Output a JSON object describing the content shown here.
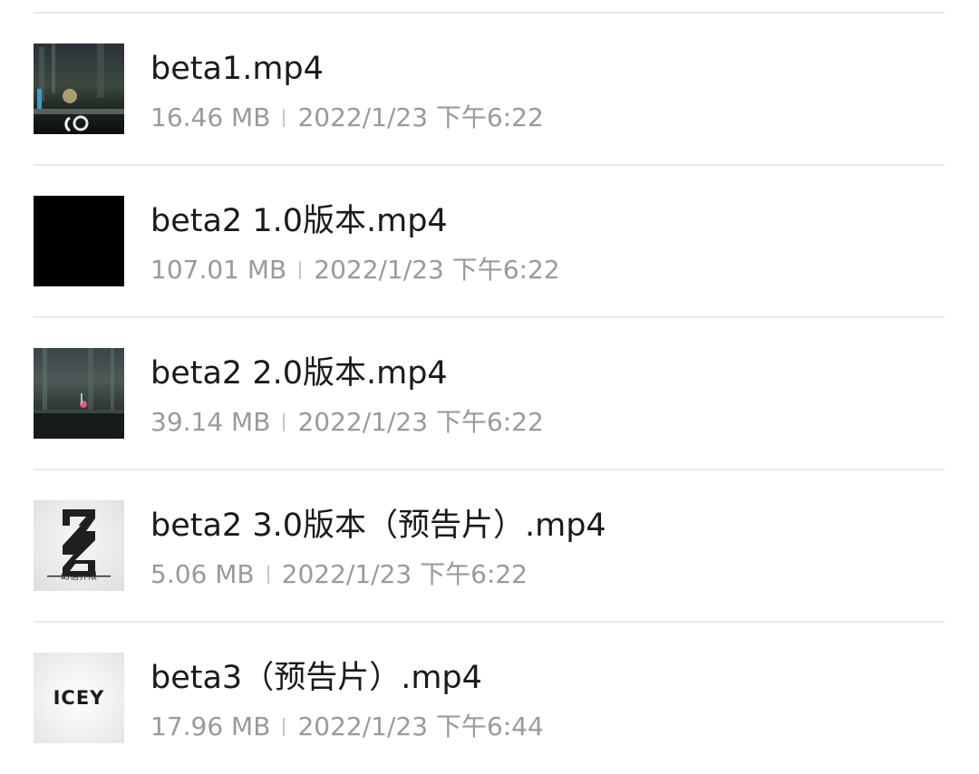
{
  "files": [
    {
      "name": "beta1.mp4",
      "size": "16.46 MB",
      "date": "2022/1/23 下午6:22",
      "thumbnail": "game-scene-thumbnail"
    },
    {
      "name": "beta2 1.0版本.mp4",
      "size": "107.01 MB",
      "date": "2022/1/23 下午6:22",
      "thumbnail": "black-thumbnail"
    },
    {
      "name": "beta2 2.0版本.mp4",
      "size": "39.14 MB",
      "date": "2022/1/23 下午6:22",
      "thumbnail": "forest-scene-thumbnail"
    },
    {
      "name": "beta2 3.0版本（预告片）.mp4",
      "size": "5.06 MB",
      "date": "2022/1/23 下午6:22",
      "thumbnail": "logo-thumbnail",
      "logo_text": "幻信界限"
    },
    {
      "name": "beta3（预告片）.mp4",
      "size": "17.96 MB",
      "date": "2022/1/23 下午6:44",
      "thumbnail": "icey-logo-thumbnail",
      "logo_text": "ICEY"
    }
  ],
  "colors": {
    "title": "#1a1a1a",
    "meta": "#9a9a9a",
    "divider": "#e9e9e9"
  }
}
